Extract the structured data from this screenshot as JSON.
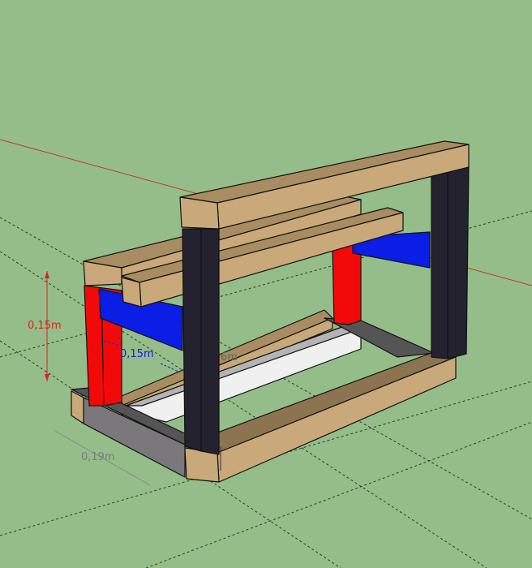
{
  "viewport": {
    "background_color": "#95bd89",
    "colors": {
      "wood_top": "#a88d62",
      "wood_side": "#c9a97a",
      "post_dark": "#23222e",
      "post_red": "#f20a0a",
      "beam_blue": "#0a1ee6",
      "rail_gray": "#6e6e6e",
      "rail_white": "#f0f0f0",
      "axis_red": "#c0362c"
    }
  },
  "dimensions": [
    {
      "label": "0,15m",
      "color": "#e02020"
    },
    {
      "label": "0,15m",
      "color": "#1a1ad8"
    },
    {
      "label": "6m",
      "color": "#666666"
    },
    {
      "label": "0,19m",
      "color": "#7a7a7a"
    }
  ]
}
